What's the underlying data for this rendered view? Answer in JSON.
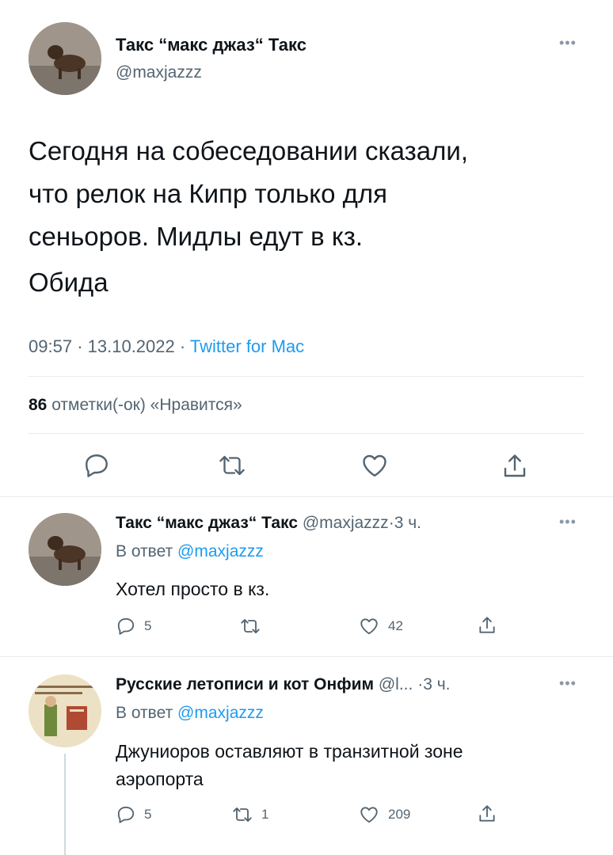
{
  "main_tweet": {
    "display_name": "Такс “макс джаз“ Такс",
    "handle": "@maxjazzz",
    "text_lines": [
      "Сегодня на собеседовании сказали,",
      "что релок на Кипр только для",
      "сеньоров. Мидлы едут в кз."
    ],
    "text_second": "Обида",
    "time": "09:57",
    "date": "13.10.2022",
    "source": "Twitter for Mac",
    "likes_count": "86",
    "likes_label": "отметки(-ок) «Нравится»"
  },
  "separator": "·",
  "reply_label": "В ответ",
  "replies": [
    {
      "display_name": "Такс “макс джаз“ Такс",
      "handle": "@maxjazzz",
      "time_ago": "3 ч.",
      "reply_to": "@maxjazzz",
      "text": "Хотел просто в кз.",
      "reply_count": "5",
      "retweet_count": "",
      "like_count": "42"
    },
    {
      "display_name": "Русские летописи и кот Онфим",
      "handle": "@l...",
      "time_ago": "3 ч.",
      "reply_to": "@maxjazzz",
      "text_lines": [
        "Джуниоров оставляют в транзитной зоне",
        "аэропорта"
      ],
      "reply_count": "5",
      "retweet_count": "1",
      "like_count": "209"
    }
  ],
  "colors": {
    "accent": "#1d9bf0",
    "muted": "#536471",
    "divider": "#e6ecf0"
  },
  "icons": [
    "more-icon",
    "reply-icon",
    "retweet-icon",
    "like-icon",
    "share-icon"
  ]
}
